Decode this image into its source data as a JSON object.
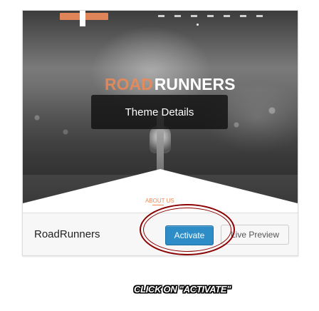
{
  "theme_card": {
    "screenshot": {
      "logo_part1": "ROAD",
      "logo_part2": "RUNNERS",
      "about_label": "ABOUT US"
    },
    "overlay_label": "Theme Details",
    "theme_name": "RoadRunners",
    "activate_label": "Activate",
    "preview_label": "Live Preview"
  },
  "annotation": {
    "instruction": "CLICK ON \"ACTIVATE\"",
    "circle_color": "#8b0000"
  },
  "colors": {
    "accent": "#f08a56",
    "activate_button": "#2e8cc6"
  }
}
